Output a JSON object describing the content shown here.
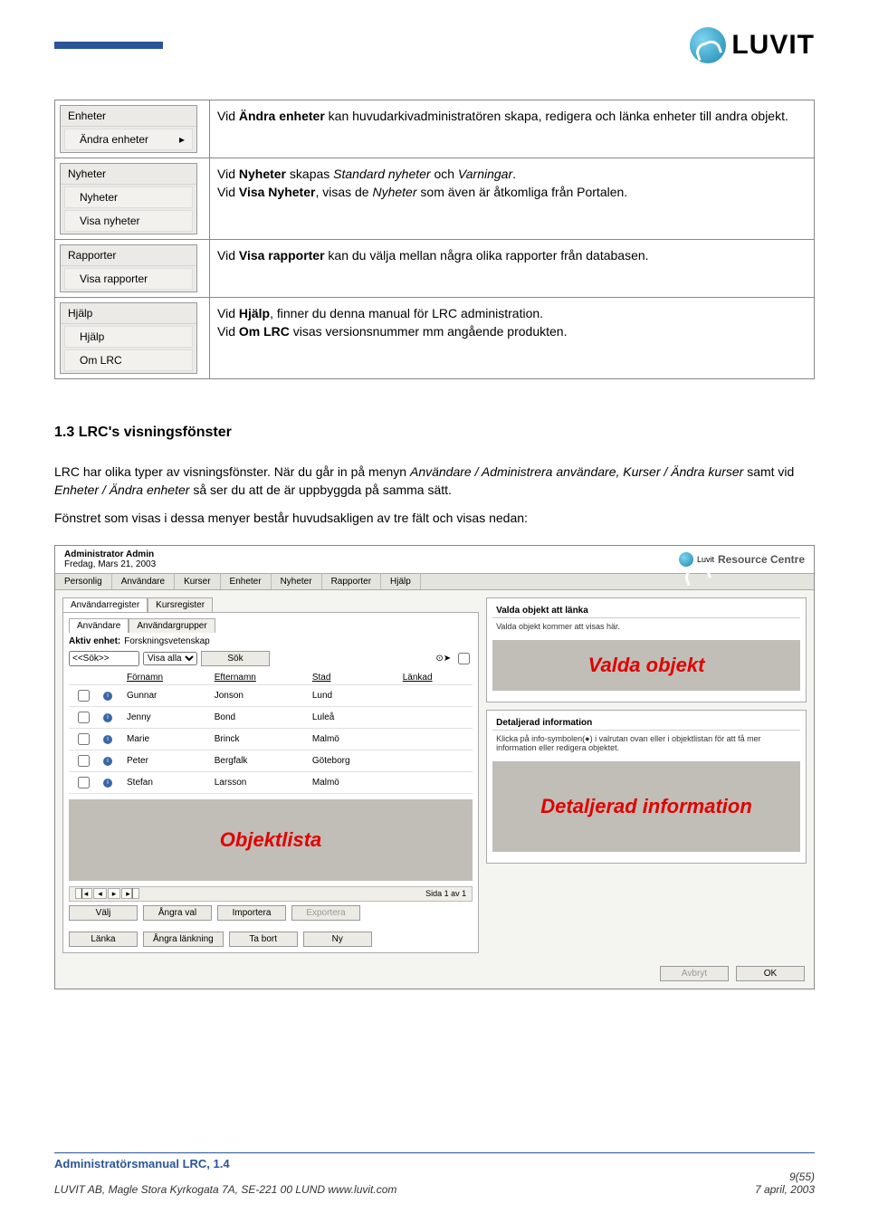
{
  "logo_text": "LUVIT",
  "menu_rows": [
    {
      "header": "Enheter",
      "items": [
        {
          "label": "Ändra enheter",
          "arrow": true
        }
      ],
      "desc_html": "Vid <b>Ändra enheter</b> kan huvudarkivadministratören skapa, redigera och länka enheter till andra objekt."
    },
    {
      "header": "Nyheter",
      "items": [
        {
          "label": "Nyheter"
        },
        {
          "label": "Visa nyheter"
        }
      ],
      "desc_html": "Vid <b>Nyheter</b> skapas <i>Standard nyheter</i> och <i>Varningar</i>.<br>Vid <b>Visa Nyheter</b>, visas de <i>Nyheter</i> som även är åtkomliga från Portalen."
    },
    {
      "header": "Rapporter",
      "items": [
        {
          "label": "Visa rapporter"
        }
      ],
      "desc_html": "Vid <b>Visa rapporter</b> kan du välja mellan några olika rapporter från databasen."
    },
    {
      "header": "Hjälp",
      "items": [
        {
          "label": "Hjälp"
        },
        {
          "label": "Om LRC"
        }
      ],
      "desc_html": "Vid <b>Hjälp</b>, finner du denna manual för LRC administration.<br>Vid <b>Om LRC</b> visas versionsnummer mm angående produkten."
    }
  ],
  "section_heading": "1.3    LRC's visningsfönster",
  "paragraphs": [
    "LRC har olika typer av visningsfönster. När du går in på menyn <i>Användare / Administrera användare, Kurser / Ändra kurser</i> samt vid <i>Enheter / Ändra enheter</i> så ser du att de är uppbyggda på samma sätt.",
    "Fönstret som visas i dessa menyer består huvudsakligen av tre fält och visas nedan:"
  ],
  "screenshot": {
    "admin_name": "Administrator Admin",
    "date": "Fredag, Mars 21, 2003",
    "rc_label": "Resource Centre",
    "top_tabs": [
      "Personlig",
      "Användare",
      "Kurser",
      "Enheter",
      "Nyheter",
      "Rapporter",
      "Hjälp"
    ],
    "left": {
      "reg_tabs": [
        "Användarregister",
        "Kursregister"
      ],
      "user_tabs": [
        "Användare",
        "Användargrupper"
      ],
      "aktiv_label": "Aktiv enhet:",
      "aktiv_value": "Forskningsvetenskap",
      "search_placeholder": "<<Sök>>",
      "visa_alla": "Visa alla",
      "sok_btn": "Sök",
      "cols": [
        "Förnamn",
        "Efternamn",
        "Stad",
        "Länkad"
      ],
      "rows": [
        {
          "f": "Gunnar",
          "e": "Jonson",
          "s": "Lund"
        },
        {
          "f": "Jenny",
          "e": "Bond",
          "s": "Luleå"
        },
        {
          "f": "Marie",
          "e": "Brinck",
          "s": "Malmö"
        },
        {
          "f": "Peter",
          "e": "Bergfalk",
          "s": "Göteborg"
        },
        {
          "f": "Stefan",
          "e": "Larsson",
          "s": "Malmö"
        }
      ],
      "objektlista_label": "Objektlista",
      "pager": "Sida 1 av 1",
      "buttons": [
        "Välj",
        "Ångra val",
        "Importera",
        "Exportera",
        "Länka",
        "Ångra länkning",
        "Ta bort",
        "Ny"
      ]
    },
    "right": {
      "valda_header": "Valda objekt att länka",
      "valda_text": "Valda objekt kommer att visas här.",
      "valda_label": "Valda objekt",
      "det_header": "Detaljerad information",
      "det_text": "Klicka på info-symbolen(●) i valrutan ovan eller i objektlistan för att få mer information eller redigera objektet.",
      "det_label": "Detaljerad information",
      "avbryt": "Avbryt",
      "ok": "OK"
    }
  },
  "footer": {
    "title": "Administratörsmanual LRC, 1.4",
    "pages": "9(55)",
    "address": "LUVIT AB, Magle Stora Kyrkogata 7A, SE-221 00  LUND www.luvit.com",
    "date": "7 april, 2003"
  }
}
